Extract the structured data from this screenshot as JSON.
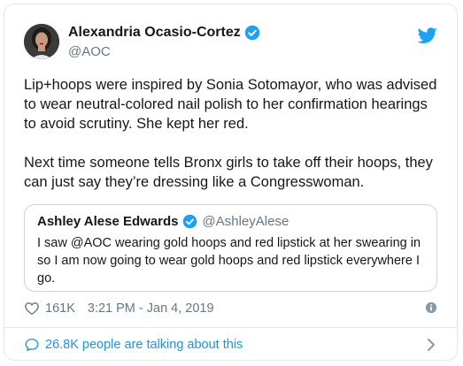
{
  "author": {
    "name": "Alexandria Ocasio-Cortez",
    "handle": "@AOC",
    "verified": true
  },
  "tweet": {
    "paragraphs": [
      "Lip+hoops were inspired by Sonia Sotomayor, who was advised to wear neutral-colored nail polish to her confirmation hearings to avoid scrutiny. She kept her red.",
      "Next time someone tells Bronx girls to take off their hoops, they can just say they’re dressing like a Congresswoman."
    ]
  },
  "quoted_tweet": {
    "name": "Ashley Alese Edwards",
    "handle": "@AshleyAlese",
    "verified": true,
    "text": "I saw @AOC wearing gold hoops and red lipstick at her swearing in so I am now going to wear gold hoops and red lipstick everywhere I go."
  },
  "meta": {
    "likes": "161K",
    "timestamp": "3:21 PM - Jan 4, 2019"
  },
  "footer": {
    "conversation": "26.8K people are talking about this"
  },
  "icons": {
    "twitter_bird": "bird-icon",
    "verified": "verified-badge-icon",
    "like": "heart-icon",
    "info": "info-icon",
    "conversation": "speech-bubble-icon",
    "navigate": "chevron-right-icon"
  },
  "colors": {
    "brand_blue": "#1da1f2",
    "link_blue": "#1b95e0",
    "secondary_text": "#657786",
    "primary_text": "#14171a",
    "border": "#e1e8ed"
  }
}
